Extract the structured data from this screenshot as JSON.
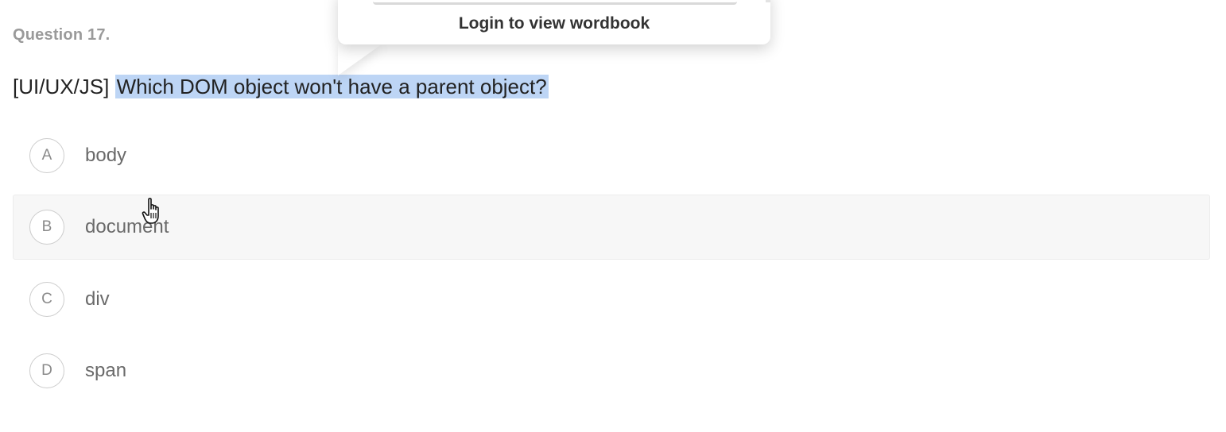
{
  "question": {
    "number": "Question 17.",
    "prefix": "[UI/UX/JS] ",
    "text": "Which DOM object won't have a parent object?"
  },
  "options": [
    {
      "letter": "A",
      "label": "body"
    },
    {
      "letter": "B",
      "label": "document"
    },
    {
      "letter": "C",
      "label": "div"
    },
    {
      "letter": "D",
      "label": "span"
    }
  ],
  "tooltip": {
    "login_label": "Login to view wordbook"
  },
  "colors": {
    "highlight": "#bdd5f5",
    "hover_background": "#f7f7f7"
  },
  "icons": {
    "cursor": "hand-pointer-icon"
  }
}
